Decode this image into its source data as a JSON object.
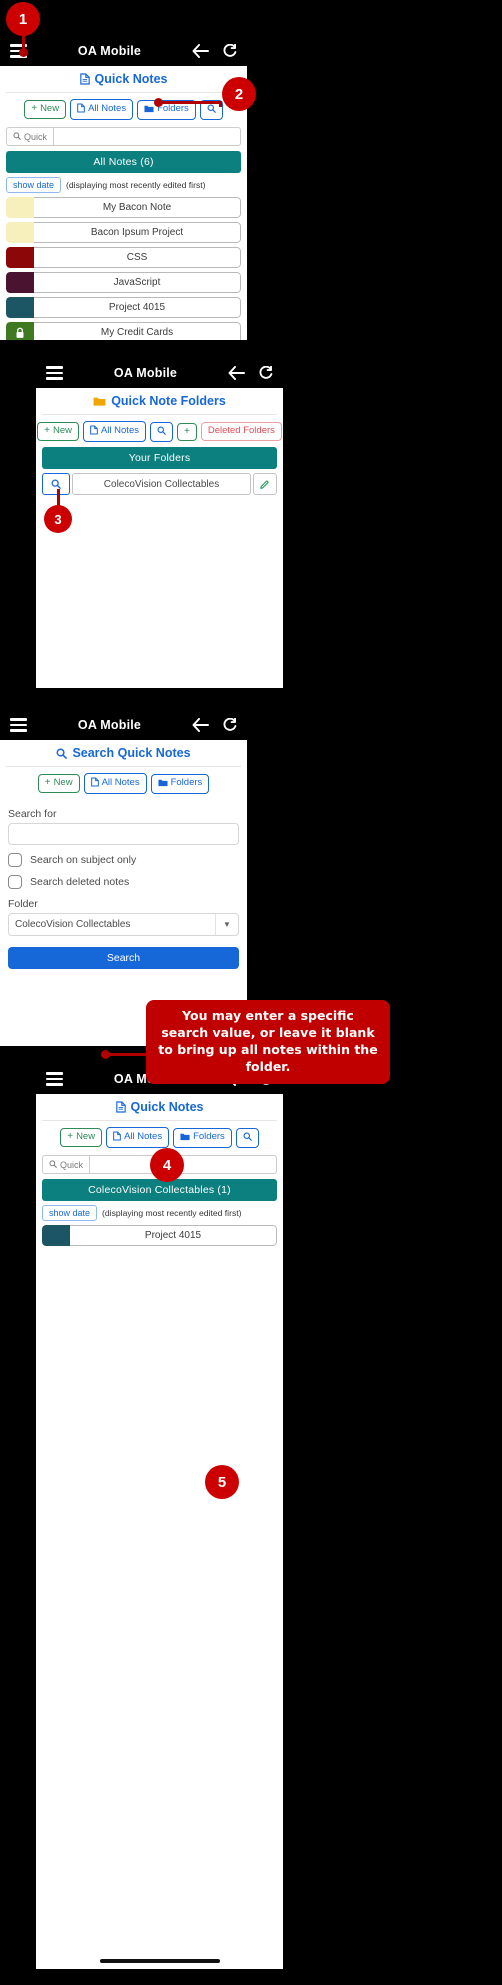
{
  "app": {
    "title": "OA Mobile",
    "menu_icon": "hamburger-icon",
    "back_icon": "back-arrow-icon",
    "reload_icon": "reload-icon"
  },
  "panel1": {
    "page_title": "Quick Notes",
    "page_title_icon": "note-document-icon",
    "toolbar": [
      {
        "label": "New",
        "glyph": "+",
        "style": "green",
        "name": "new-button"
      },
      {
        "label": "All Notes",
        "glyph": "doc",
        "style": "blue",
        "name": "all-notes-button"
      },
      {
        "label": "Folders",
        "glyph": "folder",
        "style": "blue",
        "name": "folders-button"
      },
      {
        "label": "",
        "glyph": "search",
        "style": "blue",
        "name": "search-button"
      }
    ],
    "quick_search": {
      "button_label": "Quick",
      "value": "",
      "placeholder": ""
    },
    "banner": "All Notes (6)",
    "show_date_label": "show date",
    "sort_hint": "(displaying most recently edited first)",
    "notes": [
      {
        "title": "My Bacon Note",
        "color": "#f7f0bd",
        "locked": false
      },
      {
        "title": "Bacon Ipsum Project",
        "color": "#f7f0bd",
        "locked": false
      },
      {
        "title": "CSS",
        "color": "#8c0808",
        "locked": false
      },
      {
        "title": "JavaScript",
        "color": "#4a1430",
        "locked": false
      },
      {
        "title": "Project 4015",
        "color": "#1c5564",
        "locked": false
      },
      {
        "title": "My Credit Cards",
        "color": "#3f7a22",
        "locked": true
      }
    ]
  },
  "panel2": {
    "page_title": "Quick Note Folders",
    "page_title_icon": "folder-icon",
    "toolbar": [
      {
        "label": "New",
        "glyph": "+",
        "style": "green",
        "name": "new-button"
      },
      {
        "label": "All Notes",
        "glyph": "doc",
        "style": "blue",
        "name": "all-notes-button"
      },
      {
        "label": "",
        "glyph": "search",
        "style": "blue",
        "name": "search-button"
      },
      {
        "label": "",
        "glyph": "+",
        "style": "green",
        "name": "add-folder-button"
      },
      {
        "label": "Deleted Folders",
        "glyph": "",
        "style": "red",
        "name": "deleted-folders-button"
      }
    ],
    "banner": "Your Folders",
    "folders": [
      {
        "name": "ColecoVision Collectables",
        "search_icon": "search-icon",
        "edit_icon": "pencil-icon"
      }
    ]
  },
  "panel3": {
    "page_title": "Search Quick Notes",
    "page_title_icon": "search-icon",
    "toolbar": [
      {
        "label": "New",
        "glyph": "+",
        "style": "green",
        "name": "new-button"
      },
      {
        "label": "All Notes",
        "glyph": "doc",
        "style": "blue",
        "name": "all-notes-button"
      },
      {
        "label": "Folders",
        "glyph": "folder",
        "style": "blue",
        "name": "folders-button"
      }
    ],
    "search_for_label": "Search for",
    "search_for_value": "",
    "checkboxes": [
      {
        "label": "Search on subject only",
        "checked": false
      },
      {
        "label": "Search deleted notes",
        "checked": false
      }
    ],
    "folder_label": "Folder",
    "folder_value": "ColecoVision Collectables",
    "submit_label": "Search"
  },
  "panel4": {
    "page_title": "Quick Notes",
    "page_title_icon": "note-document-icon",
    "toolbar": [
      {
        "label": "New",
        "glyph": "+",
        "style": "green",
        "name": "new-button"
      },
      {
        "label": "All Notes",
        "glyph": "doc",
        "style": "blue",
        "name": "all-notes-button"
      },
      {
        "label": "Folders",
        "glyph": "folder",
        "style": "blue",
        "name": "folders-button"
      },
      {
        "label": "",
        "glyph": "search",
        "style": "blue",
        "name": "search-button"
      }
    ],
    "quick_search": {
      "button_label": "Quick",
      "value": ""
    },
    "banner": "ColecoVision Collectables (1)",
    "show_date_label": "show date",
    "sort_hint": "(displaying most recently edited first)",
    "notes": [
      {
        "title": "Project 4015",
        "color": "#1c5564",
        "locked": false
      }
    ]
  },
  "callouts": {
    "b1": "1",
    "b2": "2",
    "b3": "3",
    "b4": "4",
    "b5": "5",
    "tooltip": "You may enter a specific search value, or leave it blank to bring up all notes within the folder."
  },
  "colors": {
    "accent_blue": "#1668d8",
    "teal": "#0c7f7f",
    "callout_red": "#cc0000",
    "green": "#2e8b57"
  }
}
